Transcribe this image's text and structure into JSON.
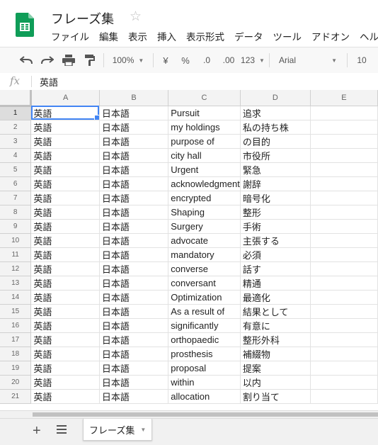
{
  "app": {
    "title": "フレーズ集",
    "star": "☆",
    "menu": [
      "ファイル",
      "編集",
      "表示",
      "挿入",
      "表示形式",
      "データ",
      "ツール",
      "アドオン",
      "ヘル"
    ]
  },
  "toolbar": {
    "zoom": "100%",
    "currency": "¥",
    "percent": "%",
    "decimal_less": ".0",
    "decimal_more": ".00",
    "more_formats": "123",
    "font": "Arial",
    "font_size": "10"
  },
  "formula_bar": {
    "fx": "fx",
    "value": "英語"
  },
  "columns": [
    "A",
    "B",
    "C",
    "D",
    "E"
  ],
  "rows": [
    {
      "n": "1",
      "a": "英語",
      "b": "日本語",
      "c": "Pursuit",
      "d": "追求"
    },
    {
      "n": "2",
      "a": "英語",
      "b": "日本語",
      "c": "my holdings",
      "d": "私の持ち株"
    },
    {
      "n": "3",
      "a": "英語",
      "b": "日本語",
      "c": "purpose of",
      "d": "の目的"
    },
    {
      "n": "4",
      "a": "英語",
      "b": "日本語",
      "c": "city hall",
      "d": "市役所"
    },
    {
      "n": "5",
      "a": "英語",
      "b": "日本語",
      "c": "Urgent",
      "d": "緊急"
    },
    {
      "n": "6",
      "a": "英語",
      "b": "日本語",
      "c": "acknowledgment",
      "d": "謝辞"
    },
    {
      "n": "7",
      "a": "英語",
      "b": "日本語",
      "c": "encrypted",
      "d": "暗号化"
    },
    {
      "n": "8",
      "a": "英語",
      "b": "日本語",
      "c": "Shaping",
      "d": "整形"
    },
    {
      "n": "9",
      "a": "英語",
      "b": "日本語",
      "c": "Surgery",
      "d": "手術"
    },
    {
      "n": "10",
      "a": "英語",
      "b": "日本語",
      "c": "advocate",
      "d": "主張する"
    },
    {
      "n": "11",
      "a": "英語",
      "b": "日本語",
      "c": "mandatory",
      "d": "必須"
    },
    {
      "n": "12",
      "a": "英語",
      "b": "日本語",
      "c": "converse",
      "d": "話す"
    },
    {
      "n": "13",
      "a": "英語",
      "b": "日本語",
      "c": "conversant",
      "d": "精通"
    },
    {
      "n": "14",
      "a": "英語",
      "b": "日本語",
      "c": "Optimization",
      "d": "最適化"
    },
    {
      "n": "15",
      "a": "英語",
      "b": "日本語",
      "c": "As a result of",
      "d": "結果として"
    },
    {
      "n": "16",
      "a": "英語",
      "b": "日本語",
      "c": "significantly",
      "d": "有意に"
    },
    {
      "n": "17",
      "a": "英語",
      "b": "日本語",
      "c": "orthopaedic",
      "d": "整形外科"
    },
    {
      "n": "18",
      "a": "英語",
      "b": "日本語",
      "c": "prosthesis",
      "d": "補綴物"
    },
    {
      "n": "19",
      "a": "英語",
      "b": "日本語",
      "c": "proposal",
      "d": "提案"
    },
    {
      "n": "20",
      "a": "英語",
      "b": "日本語",
      "c": "within",
      "d": "以内"
    },
    {
      "n": "21",
      "a": "英語",
      "b": "日本語",
      "c": "allocation",
      "d": "割り当て"
    }
  ],
  "sheet_tabs": [
    {
      "label": "フレーズ集"
    }
  ],
  "colors": {
    "accent": "#4285f4",
    "logo": "#0f9d58"
  }
}
